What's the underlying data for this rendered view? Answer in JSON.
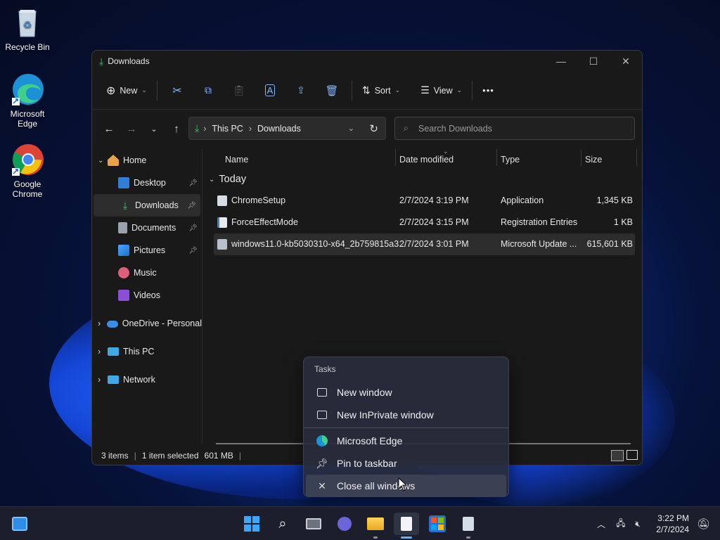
{
  "desktop": {
    "icons": [
      {
        "label": "Recycle Bin"
      },
      {
        "label": "Microsoft Edge"
      },
      {
        "label": "Google Chrome"
      }
    ]
  },
  "window": {
    "title": "Downloads",
    "toolbar": {
      "new_label": "New",
      "sort_label": "Sort",
      "view_label": "View",
      "more_label": "•••"
    },
    "address": {
      "segments": [
        "This PC",
        "Downloads"
      ]
    },
    "search": {
      "placeholder": "Search Downloads"
    },
    "sidebar": {
      "items": [
        {
          "label": "Home"
        },
        {
          "label": "Desktop"
        },
        {
          "label": "Downloads"
        },
        {
          "label": "Documents"
        },
        {
          "label": "Pictures"
        },
        {
          "label": "Music"
        },
        {
          "label": "Videos"
        },
        {
          "label": "OneDrive - Personal"
        },
        {
          "label": "This PC"
        },
        {
          "label": "Network"
        }
      ]
    },
    "columns": {
      "name": "Name",
      "date": "Date modified",
      "type": "Type",
      "size": "Size"
    },
    "group_label": "Today",
    "files": [
      {
        "name": "ChromeSetup",
        "date": "2/7/2024 3:19 PM",
        "type": "Application",
        "size": "1,345 KB"
      },
      {
        "name": "ForceEffectMode",
        "date": "2/7/2024 3:15 PM",
        "type": "Registration Entries",
        "size": "1 KB"
      },
      {
        "name": "windows11.0-kb5030310-x64_2b759815a3...",
        "date": "2/7/2024 3:01 PM",
        "type": "Microsoft Update ...",
        "size": "615,601 KB"
      }
    ],
    "status": {
      "items": "3 items",
      "selected": "1 item selected",
      "size": "601 MB",
      "sep": "|"
    }
  },
  "jumplist": {
    "header": "Tasks",
    "items": [
      {
        "label": "New window"
      },
      {
        "label": "New InPrivate window"
      },
      {
        "label": "Microsoft Edge"
      },
      {
        "label": "Pin to taskbar"
      },
      {
        "label": "Close all windows"
      }
    ]
  },
  "taskbar": {
    "time": "3:22 PM",
    "date": "2/7/2024"
  },
  "colors": {
    "accent": "#5cb3ff",
    "download_green": "#3cc26a",
    "window_bg": "#191919"
  }
}
